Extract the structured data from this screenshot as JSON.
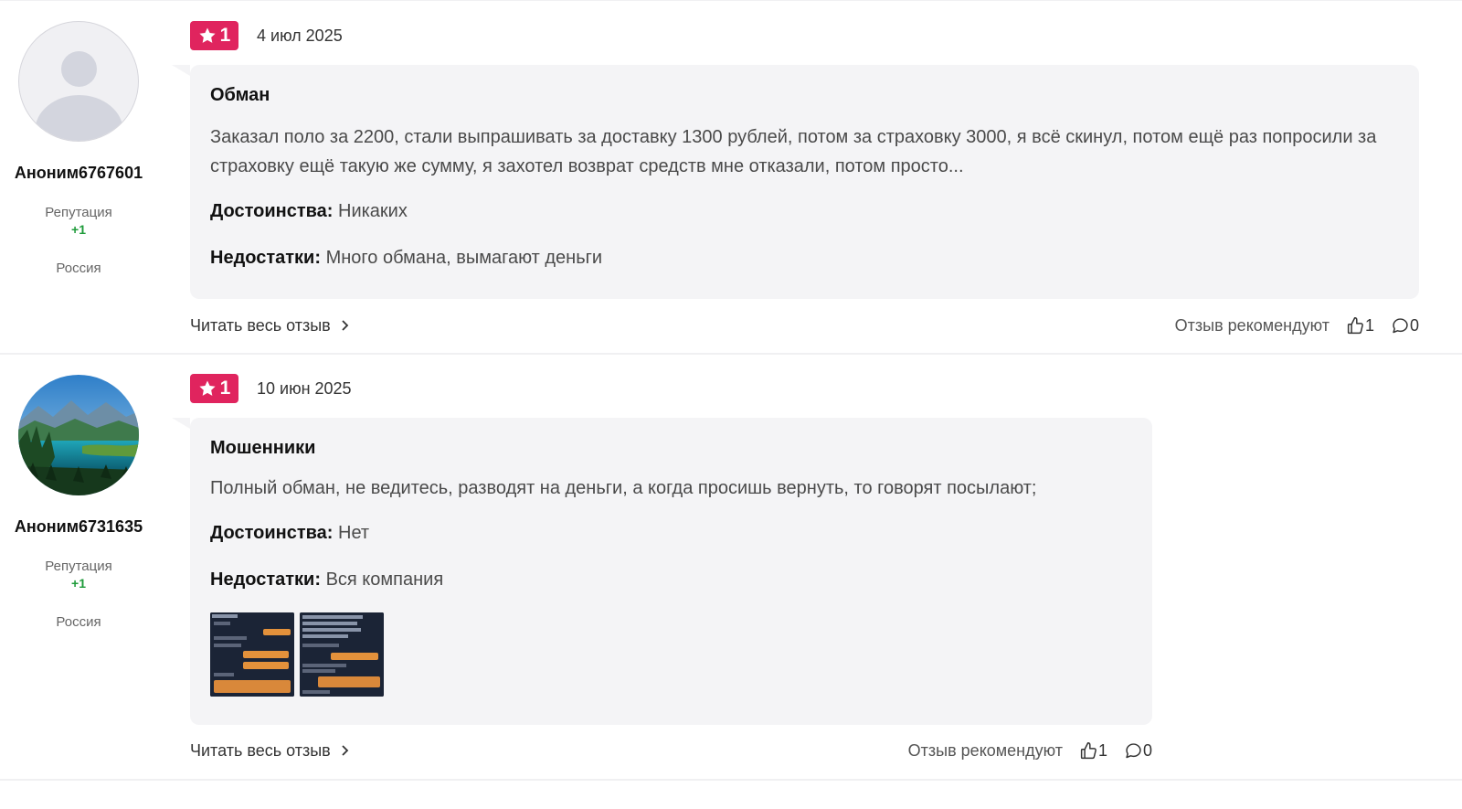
{
  "reviews": [
    {
      "author": {
        "name": "Аноним6767601",
        "reputation_label": "Репутация",
        "reputation_value": "+1",
        "country": "Россия",
        "avatar": "default-user-avatar"
      },
      "rating": "1",
      "date": "4 июл 2025",
      "title": "Обман",
      "text": "Заказал поло за 2200, стали выпрашивать за доставку 1300 рублей, потом за страховку 3000, я всё скинул, потом ещё раз попросили за страховку ещё такую же сумму, я захотел возврат средств мне отказали, потом просто...",
      "pros_label": "Достоинства:",
      "pros": "Никаких",
      "cons_label": "Недостатки:",
      "cons": "Много обмана, вымагают деньги",
      "read_more": "Читать весь отзыв",
      "recommend_label": "Отзыв рекомендуют",
      "likes": "1",
      "comments": "0"
    },
    {
      "author": {
        "name": "Аноним6731635",
        "reputation_label": "Репутация",
        "reputation_value": "+1",
        "country": "Россия",
        "avatar": "mountain-lake-photo"
      },
      "rating": "1",
      "date": "10 июн 2025",
      "title": "Мошенники",
      "text": "Полный обман, не ведитесь, разводят на деньги, а когда просишь вернуть, то говорят посылают;",
      "pros_label": "Достоинства:",
      "pros": "Нет",
      "cons_label": "Недостатки:",
      "cons": "Вся компания",
      "images": [
        "chat-screenshot-thumbnail",
        "chat-screenshot-thumbnail"
      ],
      "read_more": "Читать весь отзыв",
      "recommend_label": "Отзыв рекомендуют",
      "likes": "1",
      "comments": "0"
    }
  ],
  "colors": {
    "rating_badge": "#e0245e",
    "reputation_positive": "#1e9b3a",
    "bubble_bg": "#f4f4f6"
  }
}
